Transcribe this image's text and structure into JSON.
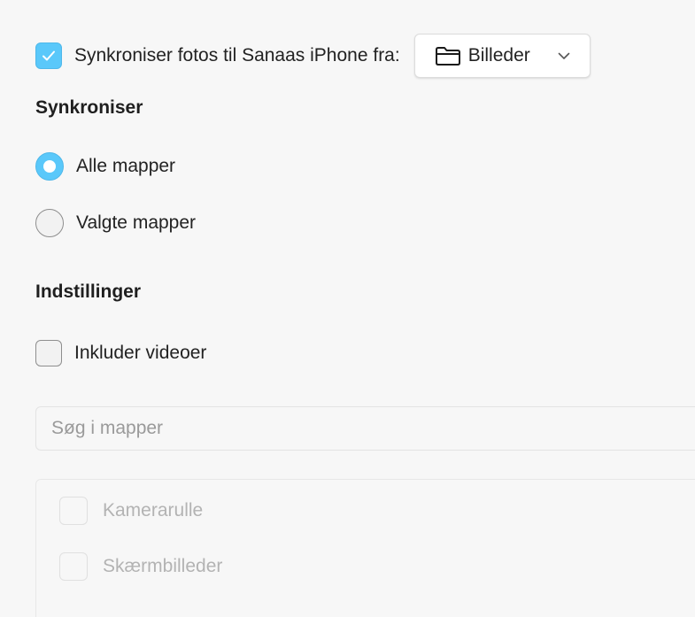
{
  "sync": {
    "label": "Synkroniser fotos til Sanaas iPhone fra:",
    "checked": true,
    "source": {
      "label": "Billeder",
      "icon": "folder-icon"
    }
  },
  "sync_section": {
    "heading": "Synkroniser",
    "options": [
      {
        "label": "Alle mapper",
        "selected": true
      },
      {
        "label": "Valgte mapper",
        "selected": false
      }
    ]
  },
  "settings_section": {
    "heading": "Indstillinger",
    "include_videos": {
      "label": "Inkluder videoer",
      "checked": false
    }
  },
  "search": {
    "placeholder": "Søg i mapper"
  },
  "folders": [
    {
      "label": "Kamerarulle",
      "checked": false,
      "disabled": true
    },
    {
      "label": "Skærmbilleder",
      "checked": false,
      "disabled": true
    }
  ],
  "colors": {
    "accent": "#5ac8fa",
    "disabled_text": "#b3b3b3"
  }
}
